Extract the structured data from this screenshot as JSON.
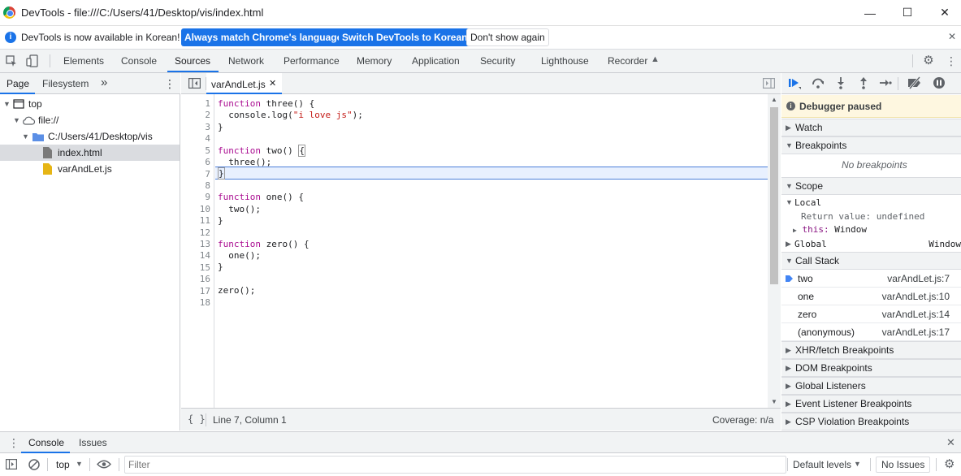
{
  "window": {
    "title": "DevTools - file:///C:/Users/41/Desktop/vis/index.html",
    "minimize": "—",
    "maximize": "☐",
    "close": "✕"
  },
  "infobar": {
    "message": "DevTools is now available in Korean!",
    "btn_match": "Always match Chrome's language",
    "btn_switch": "Switch DevTools to Korean",
    "btn_dont_show": "Don't show again",
    "close": "✕"
  },
  "tabs": [
    {
      "label": "Elements"
    },
    {
      "label": "Console"
    },
    {
      "label": "Sources"
    },
    {
      "label": "Network"
    },
    {
      "label": "Performance"
    },
    {
      "label": "Memory"
    },
    {
      "label": "Application"
    },
    {
      "label": "Security"
    },
    {
      "label": "Lighthouse"
    },
    {
      "label": "Recorder"
    }
  ],
  "navigator": {
    "tab_page": "Page",
    "tab_filesystem": "Filesystem",
    "more": "»",
    "tree": {
      "top": "top",
      "origin": "file://",
      "folder": "C:/Users/41/Desktop/vis",
      "file1": "index.html",
      "file2": "varAndLet.js"
    }
  },
  "editor": {
    "file_tab": "varAndLet.js",
    "close_tab": "✕",
    "line_numbers": [
      "1",
      "2",
      "3",
      "4",
      "5",
      "6",
      "7",
      "8",
      "9",
      "10",
      "11",
      "12",
      "13",
      "14",
      "15",
      "16",
      "17",
      "18"
    ],
    "footer_braces": "{ }",
    "cursor_pos": "Line 7, Column 1",
    "coverage": "Coverage: n/a"
  },
  "debugger": {
    "paused": "Debugger paused",
    "watch": "Watch",
    "breakpoints": "Breakpoints",
    "no_breakpoints": "No breakpoints",
    "scope": "Scope",
    "local": "Local",
    "return_value_key": "Return value:",
    "return_value": "undefined",
    "this_key": "this:",
    "this_value": "Window",
    "global": "Global",
    "global_value": "Window",
    "call_stack": "Call Stack",
    "stack": [
      {
        "fn": "two",
        "loc": "varAndLet.js:7"
      },
      {
        "fn": "one",
        "loc": "varAndLet.js:10"
      },
      {
        "fn": "zero",
        "loc": "varAndLet.js:14"
      },
      {
        "fn": "(anonymous)",
        "loc": "varAndLet.js:17"
      }
    ],
    "xhr": "XHR/fetch Breakpoints",
    "dom": "DOM Breakpoints",
    "global_listeners": "Global Listeners",
    "event_listener": "Event Listener Breakpoints",
    "csp": "CSP Violation Breakpoints"
  },
  "drawer": {
    "tab_console": "Console",
    "tab_issues": "Issues",
    "close": "✕",
    "context": "top",
    "filter_placeholder": "Filter",
    "levels": "Default levels",
    "no_issues": "No Issues"
  },
  "colors": {
    "accent": "#1a73e8",
    "keyword": "#aa0d91",
    "string": "#c41a16",
    "paused_bg": "#fef7e0"
  }
}
